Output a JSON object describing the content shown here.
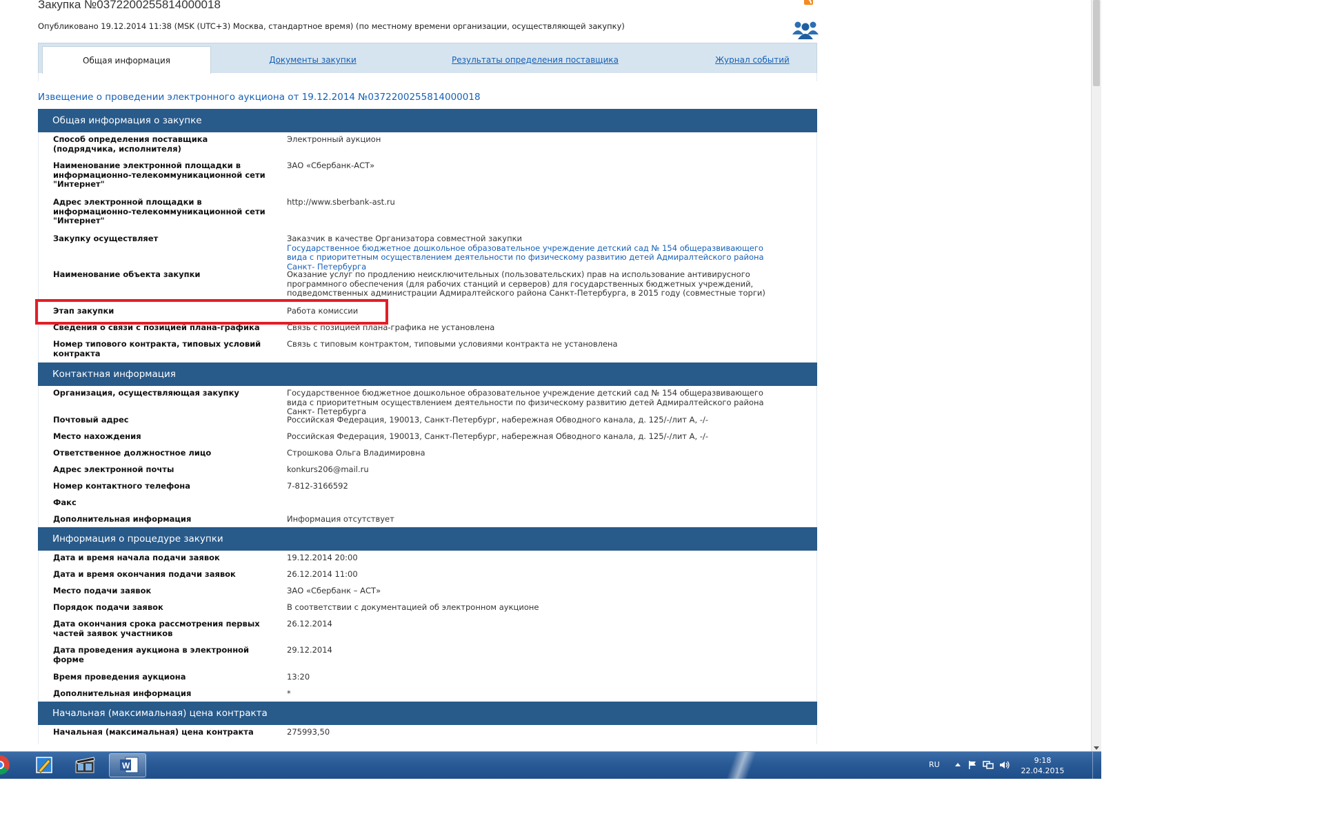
{
  "header": {
    "purchase_title": "Закупка №0372200255814000018",
    "published": "Опубликовано 19.12.2014 11:38 (MSK (UTC+3) Москва, стандартное время) (по местному времени организации, осуществляющей закупку)"
  },
  "tabs": [
    {
      "label": "Общая информация"
    },
    {
      "label": "Документы закупки"
    },
    {
      "label": "Результаты определения поставщика"
    },
    {
      "label": "Журнал событий"
    }
  ],
  "notice_title": "Извещение о проведении электронного аукциона от 19.12.2014 №0372200255814000018",
  "sections": {
    "general": {
      "title": "Общая информация о закупке",
      "rows": [
        {
          "label": "Способ определения поставщика (подрядчика, исполнителя)",
          "value": "Электронный аукцион"
        },
        {
          "label": "Наименование электронной площадки в информационно-телекоммуникационной сети \"Интернет\"",
          "value": "ЗАО «Сбербанк-АСТ»"
        },
        {
          "label": "Адрес электронной площадки в информационно-телекоммуникационной сети \"Интернет\"",
          "value": "http://www.sberbank-ast.ru"
        },
        {
          "label": "Закупку осуществляет",
          "value": "Заказчик в качестве Организатора совместной закупки",
          "link": "Государственное бюджетное дошкольное образовательное учреждение детский сад № 154 общеразвивающего вида с приоритетным осуществлением деятельности по физическому развитию детей Адмиралтейского района Санкт- Петербурга"
        },
        {
          "label": "Наименование объекта закупки",
          "value": "Оказание услуг по продлению неисключительных (пользовательских) прав на использование антивирусного программного обеспечения (для рабочих станций и серверов) для государственных бюджетных учреждений, подведомственных администрации Адмиралтейского района Санкт-Петербурга, в 2015 году (совместные торги)"
        },
        {
          "label": "Этап закупки",
          "value": "Работа комиссии"
        },
        {
          "label": "Сведения о связи с позицией плана-графика",
          "value": "Связь с позицией плана-графика не установлена"
        },
        {
          "label": "Номер типового контракта, типовых условий контракта",
          "value": "Связь с типовым контрактом, типовыми условиями контракта не установлена"
        }
      ]
    },
    "contact": {
      "title": "Контактная информация",
      "rows": [
        {
          "label": "Организация, осуществляющая закупку",
          "value": "Государственное бюджетное дошкольное образовательное учреждение детский сад № 154 общеразвивающего вида с приоритетным осуществлением деятельности по физическому развитию детей Адмиралтейского района Санкт- Петербурга"
        },
        {
          "label": "Почтовый адрес",
          "value": "Российская Федерация, 190013, Санкт-Петербург, набережная Обводного канала, д. 125/-/лит А, -/-"
        },
        {
          "label": "Место нахождения",
          "value": "Российская Федерация, 190013, Санкт-Петербург, набережная Обводного канала, д. 125/-/лит А, -/-"
        },
        {
          "label": "Ответственное должностное лицо",
          "value": "Строшкова Ольга Владимировна"
        },
        {
          "label": "Адрес электронной почты",
          "value": "konkurs206@mail.ru"
        },
        {
          "label": "Номер контактного телефона",
          "value": "7-812-3166592"
        },
        {
          "label": "Факс",
          "value": ""
        },
        {
          "label": "Дополнительная информация",
          "value": "Информация отсутствует"
        }
      ]
    },
    "procedure": {
      "title": "Информация о процедуре закупки",
      "rows": [
        {
          "label": "Дата и время начала подачи заявок",
          "value": "19.12.2014 20:00"
        },
        {
          "label": "Дата и время окончания подачи заявок",
          "value": "26.12.2014 11:00"
        },
        {
          "label": "Место подачи заявок",
          "value": "ЗАО «Сбербанк – АСТ»"
        },
        {
          "label": "Порядок подачи заявок",
          "value": "В соответствии с документацией об электронном аукционе"
        },
        {
          "label": "Дата окончания срока рассмотрения первых частей заявок участников",
          "value": "26.12.2014"
        },
        {
          "label": "Дата проведения аукциона в электронной форме",
          "value": "29.12.2014"
        },
        {
          "label": "Время проведения аукциона",
          "value": "13:20"
        },
        {
          "label": "Дополнительная информация",
          "value": "*"
        }
      ]
    },
    "price": {
      "title": "Начальная (максимальная) цена контракта",
      "rows": [
        {
          "label": "Начальная (максимальная) цена контракта",
          "value": "275993,50"
        }
      ]
    }
  },
  "taskbar": {
    "lang": "RU",
    "time": "9:18",
    "date": "22.04.2015"
  }
}
